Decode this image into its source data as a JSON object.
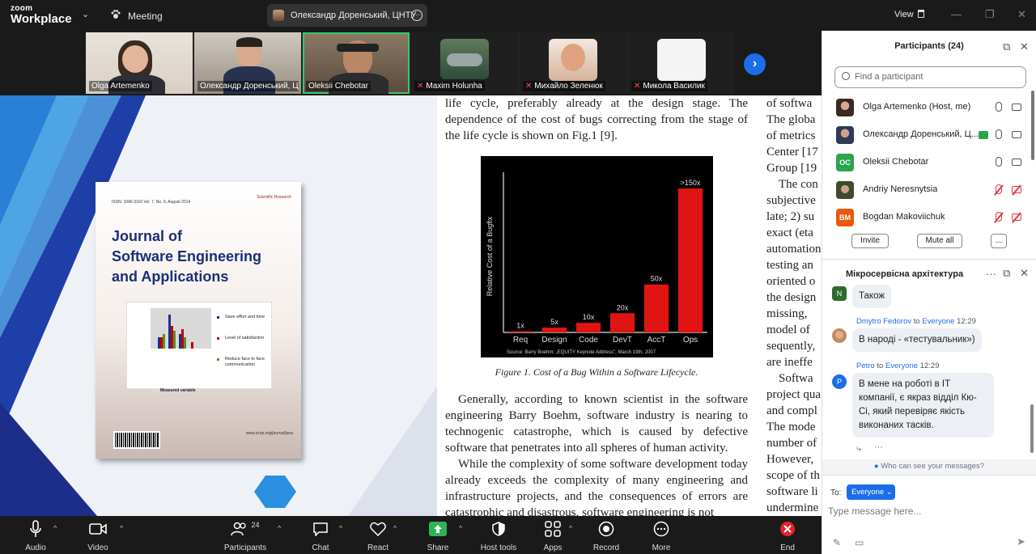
{
  "app": {
    "logo_line1": "zoom",
    "logo_line2": "Workplace",
    "meeting_label": "Meeting"
  },
  "speaker": {
    "name": "Олександр Доренський, ЦНТУ"
  },
  "view": {
    "label": "View"
  },
  "thumbnails": [
    {
      "name": "Olga Artemenko",
      "muted": false
    },
    {
      "name": "Олександр Доренський, Ц...",
      "muted": false
    },
    {
      "name": "Oleksii Chebotar",
      "muted": false
    },
    {
      "name": "Maxim Holunha",
      "muted": true
    },
    {
      "name": "Михайло Зеленюк",
      "muted": true
    },
    {
      "name": "Микола Василик",
      "muted": true
    }
  ],
  "cover": {
    "issn": "ISSN: 1045-3116   Vol. 7, No. 9, August 2014",
    "publisher": "Scientific Research",
    "title_line1": "Journal of",
    "title_line2": "Software Engineering",
    "title_line3": "and Applications",
    "measured": "Measured variable",
    "url": "www.scirp.org/journal/jsea",
    "mini_legend": [
      "Save effort and time",
      "Level of satisfaction",
      "Reduce face to face communication"
    ]
  },
  "document": {
    "p1": "life cycle, preferably already at the design stage. The dependence of the cost of bugs correcting from the stage of the life cycle is shown on Fig.1 [9].",
    "caption": "Figure 1. Cost of a Bug Within a Software Lifecycle.",
    "p2": "Generally, according to known scientist in the software engineering Barry Boehm, software industry is nearing to technogenic catastrophe, which is caused by defective software that penetrates into all spheres of human activity.",
    "p3": "While the complexity of some software development today already exceeds the complexity of many engineering and infrastructure projects, and the consequences of errors are catastrophic and disastrous, software engineering is not",
    "right_col": [
      "of softwa",
      "The globa",
      "of metrics",
      "Center [17",
      "Group [19",
      "The con",
      "subjective",
      "late; 2) su",
      "exact (eta",
      "automation",
      "testing an",
      "oriented o",
      "the design",
      "missing,",
      "model of",
      "sequently,",
      "are ineffe",
      "Softwa",
      "project qua",
      "and compl",
      "The mode",
      "number of",
      "However,",
      "scope of th",
      "software li",
      "undermine"
    ]
  },
  "chart_data": {
    "type": "bar",
    "title": "",
    "ylabel": "Relative Cost of a Bugfix",
    "xlabel": "",
    "categories": [
      "Req",
      "Design",
      "Code",
      "DevT",
      "AccT",
      "Ops"
    ],
    "values": [
      1,
      5,
      10,
      20,
      50,
      150
    ],
    "value_labels": [
      "1x",
      "5x",
      "10x",
      "20x",
      "50x",
      ">150x"
    ],
    "source": "Source: Barry Boehm: „EQUITY Keynote Address\", March 19th, 2007",
    "bar_color": "#e11414"
  },
  "toolbar": {
    "audio": "Audio",
    "video": "Video",
    "participants": "Participants",
    "participants_count": "24",
    "chat": "Chat",
    "react": "React",
    "share": "Share",
    "host_tools": "Host tools",
    "apps": "Apps",
    "record": "Record",
    "more": "More",
    "end": "End"
  },
  "participants_panel": {
    "title": "Participants (24)",
    "search_placeholder": "Find a participant",
    "list": [
      {
        "name": "Olga Artemenko (Host, me)",
        "initials": "",
        "color": "#444444",
        "muted": false,
        "video_off": false
      },
      {
        "name": "Олександр Доренський, Ц...",
        "initials": "",
        "color": "#3b4a66",
        "muted": false,
        "video_off": false
      },
      {
        "name": "Oleksii Chebotar",
        "initials": "OC",
        "color": "#2ea44f",
        "muted": false,
        "video_off": false
      },
      {
        "name": "Andriy Neresnytsia",
        "initials": "",
        "color": "#556b2f",
        "muted": true,
        "video_off": true
      },
      {
        "name": "Bogdan Makoviichuk",
        "initials": "BM",
        "color": "#e8590c",
        "muted": true,
        "video_off": true
      }
    ],
    "invite": "Invite",
    "mute_all": "Mute all",
    "more": "..."
  },
  "chat_panel": {
    "title": "Мікросервісна архітектура",
    "messages": [
      {
        "initial": "N",
        "color": "#2f6b2f",
        "sender": "",
        "to": "",
        "recipient": "",
        "time": "",
        "text": "Також"
      },
      {
        "initial": "",
        "color": "#c58a5a",
        "sender": "Dmytro Fedorov",
        "to": "to",
        "recipient": "Everyone",
        "time": "12:29",
        "text": "В народі - «тестувальник»)"
      },
      {
        "initial": "P",
        "color": "#1b6ee8",
        "sender": "Petro",
        "to": "to",
        "recipient": "Everyone",
        "time": "12:29",
        "text": "В мене на роботі в IT компанії, є якраз відділ Кю-Сі, який перевіряє якість виконаних тасків."
      }
    ],
    "who_can_see": "Who can see your messages?",
    "to_label": "To:",
    "to_value": "Everyone",
    "input_placeholder": "Type message here..."
  }
}
